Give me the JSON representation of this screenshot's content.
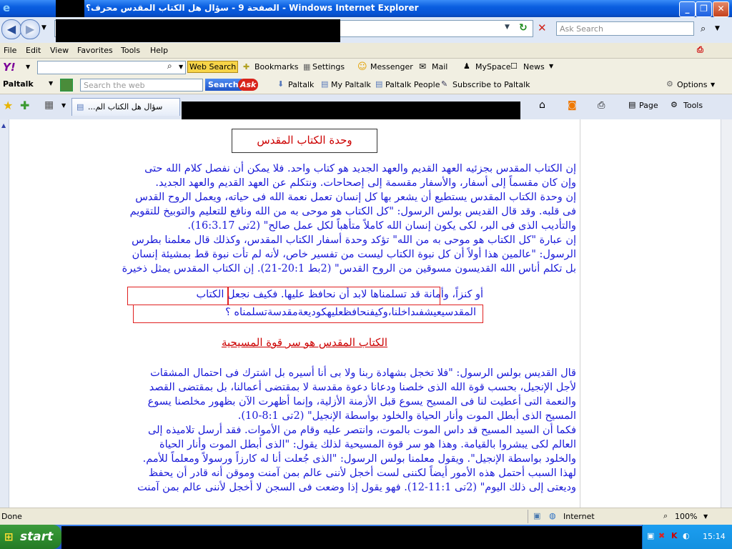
{
  "window": {
    "title": "الصفحة 9 - سؤال هل الكتاب المقدس محرف؟ - Windows Internet Explorer",
    "ie_icon_glyph": "e"
  },
  "addressbar": {
    "search_placeholder": "Ask Search"
  },
  "menu": [
    "File",
    "Edit",
    "View",
    "Favorites",
    "Tools",
    "Help"
  ],
  "yahoo_toolbar": {
    "logo": "Y!",
    "web_search_label": "Web Search",
    "bookmarks_label": "Bookmarks",
    "settings_label": "Settings",
    "messenger_label": "Messenger",
    "mail_label": "Mail",
    "myspace_label": "MySpace",
    "news_label": "News"
  },
  "paltalk_toolbar": {
    "brand": "Paltalk",
    "search_placeholder": "Search the web",
    "search_button": "Search",
    "ask_badge": "Ask",
    "links": [
      "Paltalk",
      "My Paltalk",
      "Paltalk People",
      "Subscribe to Paltalk"
    ],
    "options_label": "Options"
  },
  "tabbar": {
    "tab_label": "سؤال هل الكتاب الم...",
    "page_label": "Page",
    "tools_label": "Tools"
  },
  "content": {
    "heading1": "وحدة الكتاب المقدس",
    "para1_lines": [
      "إن الكتاب المقدس بجزئيه العهد القديم والعهد الجديد هو كتاب واحد. فلا يمكن أن نفصل كلام الله حتى",
      "وإن كان مقسماً إلى أسفار، والأسفار مقسمة إلى إصحاحات. ونتكلم عن العهد القديم والعهد الجديد.",
      "إن وحدة الكتاب المقدس يستطيع أن يشعر بها كل إنسان تعمل نعمة الله فى حياته، ويعمل الروح القدس",
      "فى قلبه. وقد قال القديس بولس الرسول: \"كل الكتاب هو موحى به من الله ونافع للتعليم والتوبيخ للتقويم",
      "والتأديب الذى فى البر، لكى يكون إنسان الله كاملاً متأهباً لكل عمل صالح\" (2تى 16:3.17).",
      "إن عبارة \"كل الكتاب هو موحى به من الله\" تؤكد وحدة أسفار الكتاب المقدس، وكذلك قال معلمنا بطرس",
      "الرسول: \"عالمين هذا أولاً أن كل نبوة الكتاب ليست من تفسير خاص، لأنه لم تأت نبوة قط بمشيئة إنسان",
      "بل تكلم أناس الله القديسون مسوقين من الروح القدس\" (2بط 20:1-21). إن الكتاب المقدس يمثل ذخيرة",
      "أو كنزاً، وأمانة قد تسلمناها لابد أن نحافظ عليها. فكيف نجعل الكتاب",
      "المقدسيعيشفىداخلنا،وكيفنحافظعليهكوديعةمقدسةتسلمناه ؟"
    ],
    "heading2": "الكتاب المقدس هو سر قوة المسيحية",
    "para2_lines": [
      "قال القديس بولس الرسول: \"فلا تخجل بشهادة ربنا ولا بى أنا أسيره بل اشترك فى احتمال المشقات",
      "لأجل الإنجيل، بحسب قوة الله الذى خلصنا ودعانا دعوة مقدسة لا بمقتضى أعمالنا، بل بمقتضى القصد",
      "والنعمة التى أعطيت لنا فى المسيح يسوع قبل الأزمنة الأزلية، وإنما أظهرت الآن بظهور مخلصنا يسوع",
      "المسيح الذى أبطل الموت وأنار الحياة والخلود بواسطة الإنجيل\" (2تى 8:1-10).",
      "فكما أن السيد المسيح قد داس الموت بالموت، وانتصر عليه وقام من الأموات. فقد أرسل تلاميذه إلى",
      "العالم لكى يبشروا بالقيامة. وهذا هو سر قوة المسيحية لذلك يقول: \"الذى أبطل الموت وأنار الحياة",
      "والخلود بواسطة الإنجيل\". ويقول معلمنا بولس الرسول: \"الذى جُعلت أنا له كارزاً ورسولاً ومعلماً للأمم.",
      "لهذا السبب أحتمل هذه الأمور أيضاً لكننى لست أخجل لأننى عالم بمن آمنت وموقن أنه قادر أن يحفظ",
      "وديعتى إلى ذلك اليوم\" (2تى 11:1-12). فهو يقول إذا وضعت فى السجن لا أخجل لأننى عالم بمن آمنت"
    ]
  },
  "statusbar": {
    "status": "Done",
    "zone": "Internet",
    "zoom": "100%"
  },
  "taskbar": {
    "start_label": "start",
    "clock": "15:14"
  }
}
